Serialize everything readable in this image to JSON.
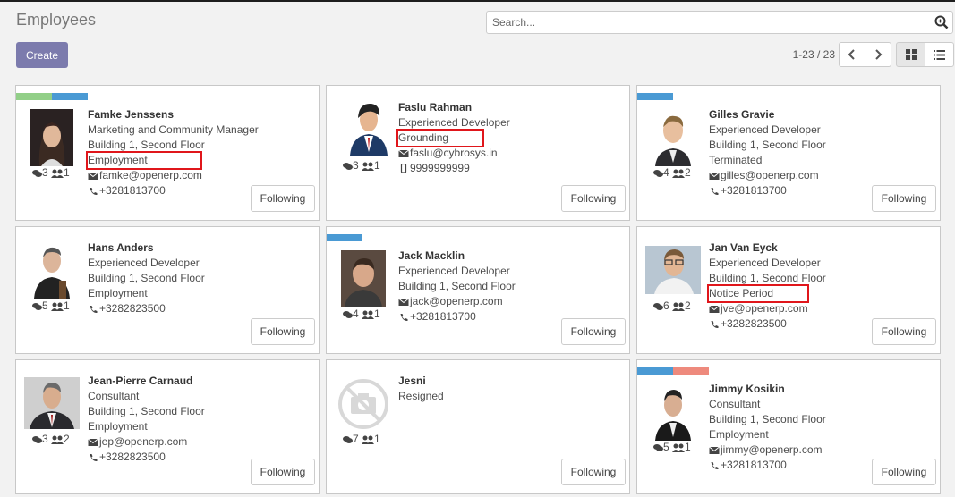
{
  "header": {
    "title": "Employees",
    "search_placeholder": "Search...",
    "create_label": "Create",
    "pager": "1-23 / 23"
  },
  "colors": {
    "primary": "#7c7bad",
    "tag_green": "#92cf88",
    "tag_blue": "#4a9ad4",
    "tag_salmon": "#ee8a7d",
    "highlight": "#e0161b"
  },
  "employees": [
    {
      "name": "Famke Jenssens",
      "job": "Marketing and Community Manager",
      "location": "Building 1, Second Floor",
      "stage": "Employment",
      "email": "famke@openerp.com",
      "phone": "+3281813700",
      "messages": "3",
      "followers": "1",
      "follow_label": "Following"
    },
    {
      "name": "Faslu Rahman",
      "job": "Experienced Developer",
      "stage": "Grounding",
      "email": "faslu@cybrosys.in",
      "mobile": "9999999999",
      "messages": "3",
      "followers": "1",
      "follow_label": "Following"
    },
    {
      "name": "Gilles Gravie",
      "job": "Experienced Developer",
      "location": "Building 1, Second Floor",
      "stage": "Terminated",
      "email": "gilles@openerp.com",
      "phone": "+3281813700",
      "messages": "4",
      "followers": "2",
      "follow_label": "Following"
    },
    {
      "name": "Hans Anders",
      "job": "Experienced Developer",
      "location": "Building 1, Second Floor",
      "stage": "Employment",
      "phone": "+3282823500",
      "messages": "5",
      "followers": "1",
      "follow_label": "Following"
    },
    {
      "name": "Jack Macklin",
      "job": "Experienced Developer",
      "location": "Building 1, Second Floor",
      "email": "jack@openerp.com",
      "phone": "+3281813700",
      "messages": "4",
      "followers": "1",
      "follow_label": "Following"
    },
    {
      "name": "Jan Van Eyck",
      "job": "Experienced Developer",
      "location": "Building 1, Second Floor",
      "stage": "Notice Period",
      "email": "jve@openerp.com",
      "phone": "+3282823500",
      "messages": "6",
      "followers": "2",
      "follow_label": "Following"
    },
    {
      "name": "Jean-Pierre Carnaud",
      "job": "Consultant",
      "location": "Building 1, Second Floor",
      "stage": "Employment",
      "email": "jep@openerp.com",
      "phone": "+3282823500",
      "messages": "3",
      "followers": "2",
      "follow_label": "Following"
    },
    {
      "name": "Jesni",
      "job": "Resigned",
      "messages": "7",
      "followers": "1",
      "follow_label": "Following"
    },
    {
      "name": "Jimmy Kosikin",
      "job": "Consultant",
      "location": "Building 1, Second Floor",
      "stage": "Employment",
      "email": "jimmy@openerp.com",
      "phone": "+3281813700",
      "messages": "5",
      "followers": "1",
      "follow_label": "Following"
    }
  ]
}
